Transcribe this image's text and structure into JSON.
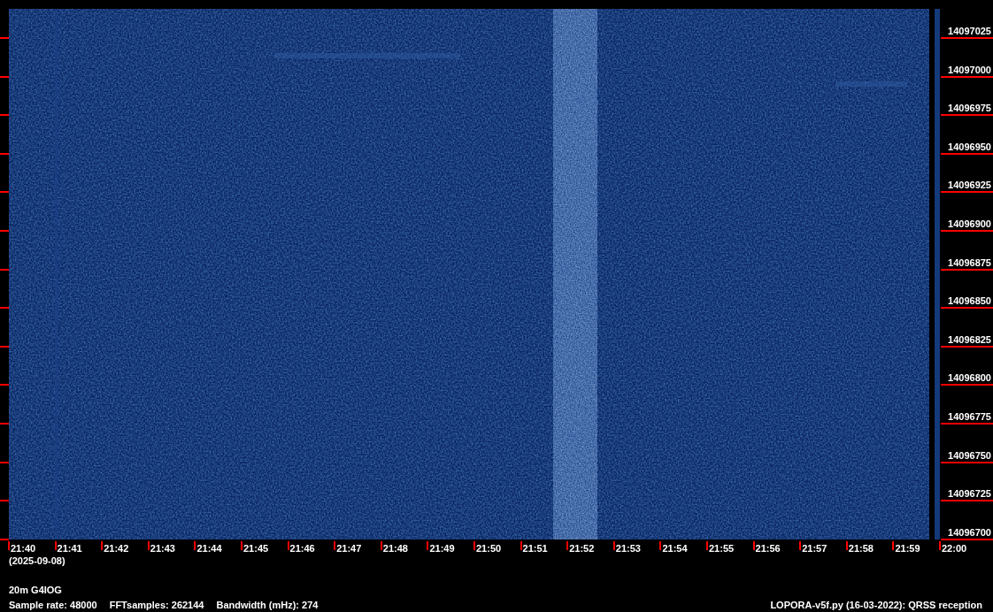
{
  "spectrogram": {
    "frequency_labels": [
      "14097025",
      "14097000",
      "14096975",
      "14096950",
      "14096925",
      "14096900",
      "14096875",
      "14096850",
      "14096825",
      "14096800",
      "14096775",
      "14096750",
      "14096725",
      "14096700"
    ],
    "time_labels": [
      "21:40",
      "21:41",
      "21:42",
      "21:43",
      "21:44",
      "21:45",
      "21:46",
      "21:47",
      "21:48",
      "21:49",
      "21:50",
      "21:51",
      "21:52",
      "21:53",
      "21:54",
      "21:55",
      "21:56",
      "21:57",
      "21:58",
      "21:59",
      "22:00"
    ],
    "date": "(2025-09-08)"
  },
  "station": "20m G4IOG",
  "parameters": [
    "Sample rate: 48000",
    "FFTsamples: 262144",
    "Bandwidth (mHz): 274"
  ],
  "software": "LOPORA-v5f.py (16-03-2022): QRSS reception"
}
